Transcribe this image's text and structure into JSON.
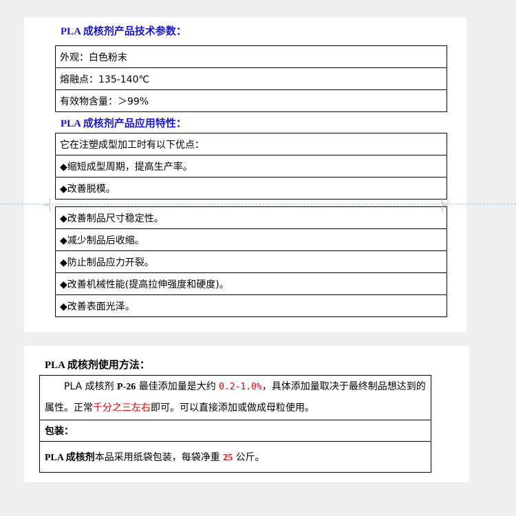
{
  "spec": {
    "title": "PLA 成核剂产品技术参数：",
    "rows": [
      "外观：白色粉末",
      "熔融点：135-140℃",
      "有效物含量：＞99%"
    ]
  },
  "features": {
    "title": "PLA 成核剂产品应用特性：",
    "rows_part1": [
      "它在注塑成型加工时有以下优点：",
      "◆缩短成型周期，提高生产率。",
      "◆改善脱模。"
    ],
    "rows_part2": [
      "◆改善制品尺寸稳定性。",
      "◆减少制品后收缩。",
      "◆防止制品应力开裂。",
      "◆改善机械性能(提高拉伸强度和硬度)。",
      "◆改善表面光泽。"
    ]
  },
  "usage": {
    "title": "PLA 成核剂使用方法：",
    "p1_a": "PLA 成核剂 ",
    "p1_b": "P-26",
    "p1_c": " 最佳添加量是大约 ",
    "p1_d": "0.2-1.0%",
    "p1_e": "，具体添加量取决于最终制品想达到的属性。正常",
    "p1_f": "千分之三左右",
    "p1_g": "即可。可以直接添加或做成母粒使用。",
    "packaging_label": "包装：",
    "pack_a": "PLA 成核剂",
    "pack_b": "本品采用纸袋包装，每袋净重 ",
    "pack_c": "25",
    "pack_d": " 公斤。"
  },
  "colors": {
    "heading_blue": "#1a16c8",
    "highlight_red": "#e00000"
  }
}
